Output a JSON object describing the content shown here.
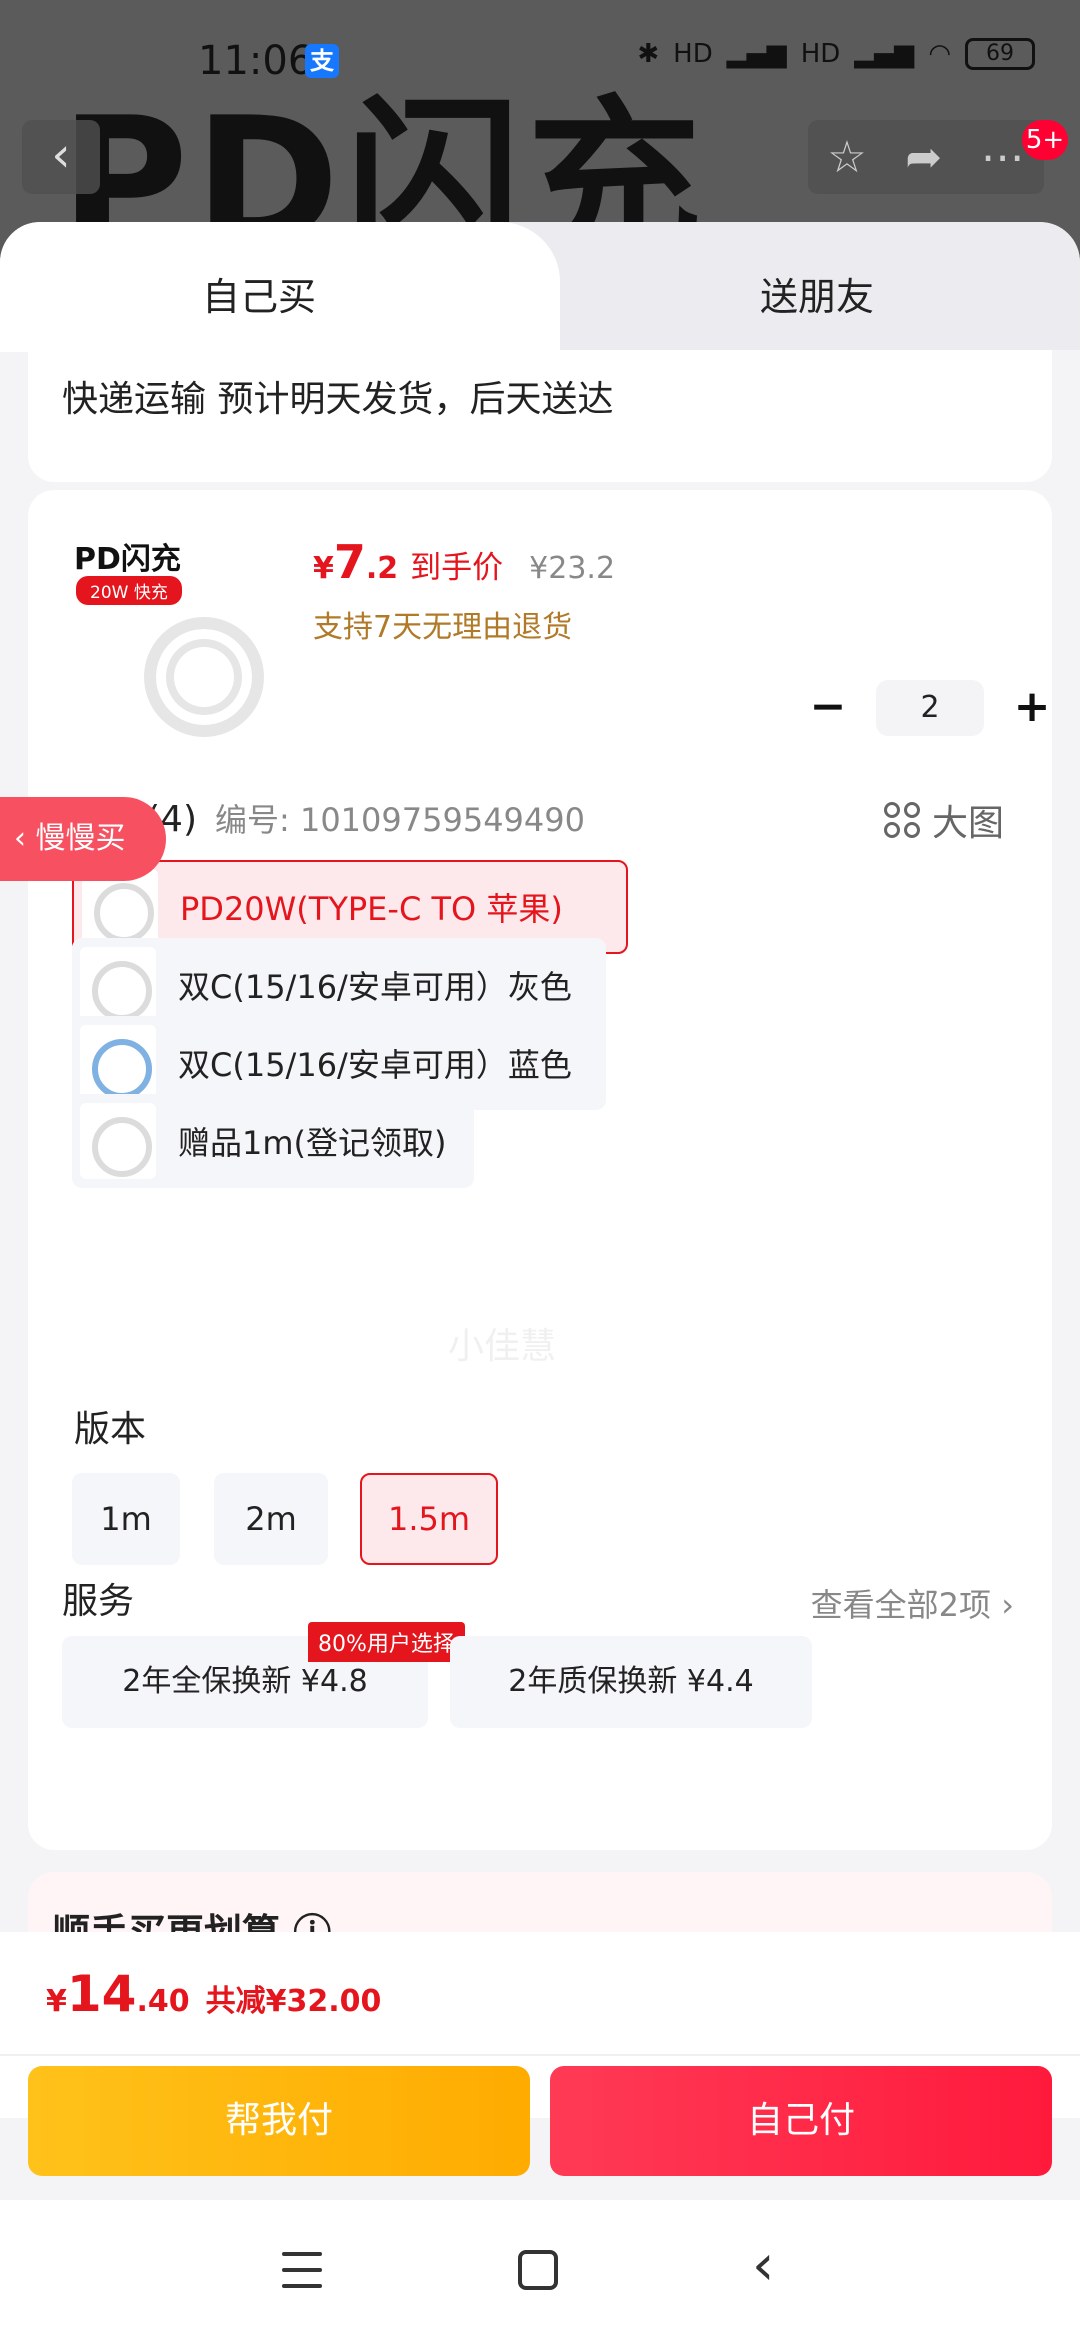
{
  "status_bar": {
    "time": "11:06",
    "app_badge": "支",
    "battery": "69",
    "signal_labels": [
      "HD",
      "HD"
    ]
  },
  "background": {
    "product_title": "PD闪充",
    "notification_count": "5+"
  },
  "tabs": {
    "self": "自己买",
    "friend": "送朋友"
  },
  "shipping": {
    "text": "快递运输 预计明天发货，后天送达"
  },
  "product": {
    "thumb_title": "PD闪充",
    "thumb_badge": "20W 快充",
    "price_currency": "¥",
    "price_int": "7",
    "price_dec": ".2",
    "price_tag": "到手价",
    "original_price": "¥23.2",
    "return_policy": "支持7天无理由退货",
    "quantity": "2",
    "minus": "−",
    "plus": "+"
  },
  "color": {
    "label": "颜色(4)",
    "code": "编号: 10109759549490",
    "big_image": "大图",
    "options": [
      {
        "label": "PD20W(TYPE-C TO 苹果)",
        "selected": true
      },
      {
        "label": "双C(15/16/安卓可用）灰色",
        "selected": false
      },
      {
        "label": "双C(15/16/安卓可用）蓝色",
        "selected": false
      },
      {
        "label": "赠品1m(登记领取)",
        "selected": false
      }
    ]
  },
  "version": {
    "label": "版本",
    "options": [
      "1m",
      "2m",
      "1.5m"
    ],
    "selected": "1.5m"
  },
  "service": {
    "label": "服务",
    "see_all": "查看全部2项 ›",
    "badge": "80%用户选择",
    "options": [
      "2年全保换新  ¥4.8",
      "2年质保换新  ¥4.4"
    ]
  },
  "bundle": {
    "title": "顺手买更划算 ⓘ"
  },
  "side_tab": {
    "label": "慢慢买"
  },
  "watermark": "小佳慧",
  "footer": {
    "total_currency": "¥",
    "total_int": "14",
    "total_dec": ".40",
    "total_save": "共减¥32.00",
    "pay_friend": "帮我付",
    "pay_self": "自己付"
  },
  "colors": {
    "accent_red": "#e4151d",
    "gold": "#ffb300",
    "pay_red": "#ff2a46"
  }
}
